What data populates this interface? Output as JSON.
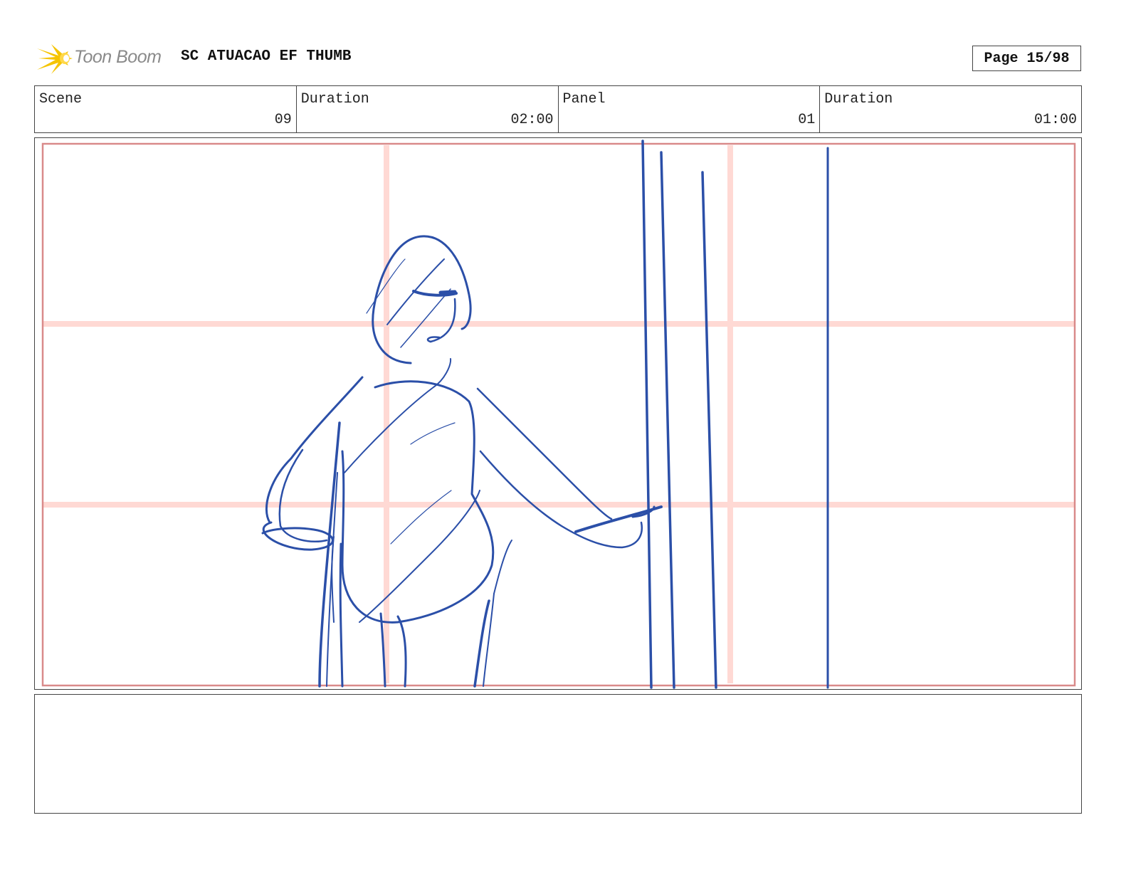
{
  "header": {
    "logo_text": "Toon Boom",
    "title": "SC ATUACAO EF THUMB",
    "page": "Page 15/98"
  },
  "info": [
    {
      "label": "Scene",
      "value": "09"
    },
    {
      "label": "Duration",
      "value": "02:00"
    },
    {
      "label": "Panel",
      "value": "01"
    },
    {
      "label": "Duration",
      "value": "01:00"
    }
  ],
  "colors": {
    "sketch": "#2b4fa8",
    "safe_frame": "#d98a8a",
    "grid": "#ffd9d4",
    "logo_yellow": "#f5c400",
    "logo_text": "#8a8a8a"
  },
  "notes": ""
}
